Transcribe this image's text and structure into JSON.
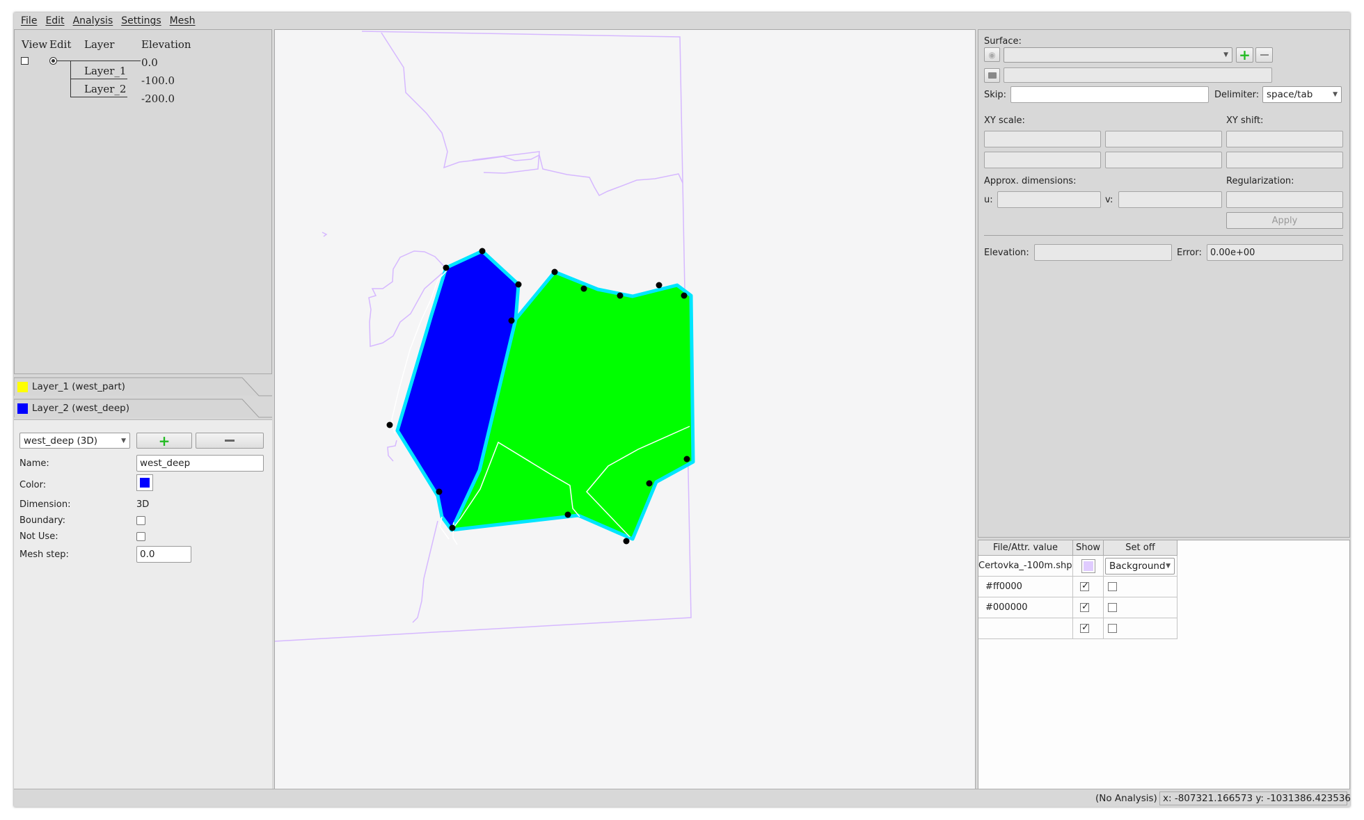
{
  "menu": [
    "File",
    "Edit",
    "Analysis",
    "Settings",
    "Mesh"
  ],
  "layer_tree": {
    "col_view": "View",
    "col_edit": "Edit",
    "col_layer": "Layer",
    "col_elevation": "Elevation",
    "layers": [
      "Layer_1",
      "Layer_2"
    ],
    "elevations": [
      "0.0",
      "-100.0",
      "-200.0"
    ]
  },
  "layer_tabs": [
    {
      "label": "Layer_1 (west_part)",
      "color": "#ffff00"
    },
    {
      "label": "Layer_2 (west_deep)",
      "color": "#0000ff"
    }
  ],
  "props": {
    "region_select": "west_deep (3D)",
    "name_label": "Name:",
    "name_value": "west_deep",
    "color_label": "Color:",
    "color_value": "#0000ff",
    "dimension_label": "Dimension:",
    "dimension_value": "3D",
    "boundary_label": "Boundary:",
    "notuse_label": "Not Use:",
    "meshstep_label": "Mesh step:",
    "meshstep_value": "0.0"
  },
  "surface": {
    "surface_label": "Surface:",
    "skip_label": "Skip:",
    "delimiter_label": "Delimiter:",
    "delimiter_value": "space/tab",
    "xyscale_label": "XY scale:",
    "xyshift_label": "XY shift:",
    "approx_label": "Approx. dimensions:",
    "regularization_label": "Regularization:",
    "u_label": "u:",
    "v_label": "v:",
    "apply_label": "Apply",
    "elevation_label": "Elevation:",
    "error_label": "Error:",
    "error_value": "0.00e+00"
  },
  "file_table": {
    "headers": [
      "File/Attr. value",
      "Show",
      "Set off"
    ],
    "rows": [
      {
        "name": "Certovka_-100m.shp",
        "show": false,
        "setoff": "Background",
        "swatch": "#e0ccff"
      },
      {
        "name": "#ff0000",
        "show": true,
        "setoff": false
      },
      {
        "name": "#000000",
        "show": true,
        "setoff": false
      },
      {
        "name": "",
        "show": true,
        "setoff": false
      }
    ]
  },
  "status": {
    "analysis": "(No Analysis)",
    "coords": "x: -807321.166573  y: -1031386.423536"
  },
  "map_colors": {
    "region_blue": "#0000ff",
    "region_green": "#00ff00",
    "outline_cyan": "#00e5ff",
    "shape_lines": "#d6b8ff"
  }
}
